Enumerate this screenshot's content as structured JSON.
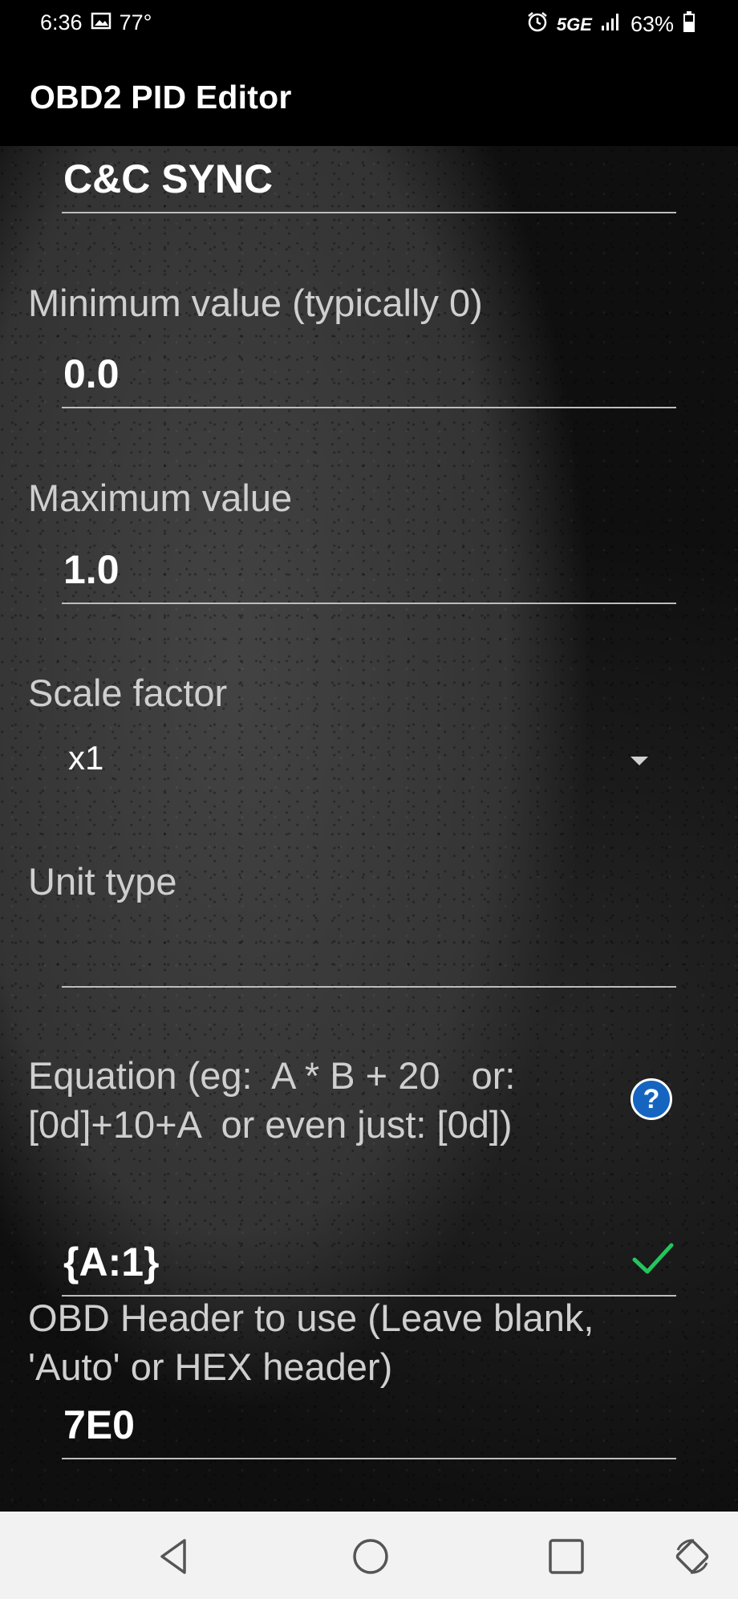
{
  "status_bar": {
    "time": "6:36",
    "temperature": "77°",
    "network": "5GE",
    "battery": "63%",
    "icons": [
      "image-icon",
      "alarm-icon",
      "signal-icon",
      "battery-icon"
    ]
  },
  "app_bar": {
    "title": "OBD2 PID Editor"
  },
  "form": {
    "name_value": "C&C SYNC",
    "min_label": "Minimum value (typically 0)",
    "min_value": "0.0",
    "max_label": "Maximum value",
    "max_value": "1.0",
    "scale_label": "Scale factor",
    "scale_value": "x1",
    "unit_label": "Unit type",
    "unit_value": "",
    "equation_label_line1": "Equation (eg:  A * B + 20   or:",
    "equation_label_line2": "[0d]+10+A  or even just: [0d])",
    "equation_value": "{A:1}",
    "equation_help": "?",
    "header_label_line1": "OBD Header to use (Leave blank,",
    "header_label_line2": "'Auto' or HEX header)",
    "header_value": "7E0"
  },
  "colors": {
    "accent_help": "#1565c0",
    "check_green": "#22c55e",
    "nav_bg": "#f2f2f2"
  },
  "nav_bar": {
    "icons": [
      "back-icon",
      "home-icon",
      "recents-icon",
      "rotate-icon"
    ]
  }
}
